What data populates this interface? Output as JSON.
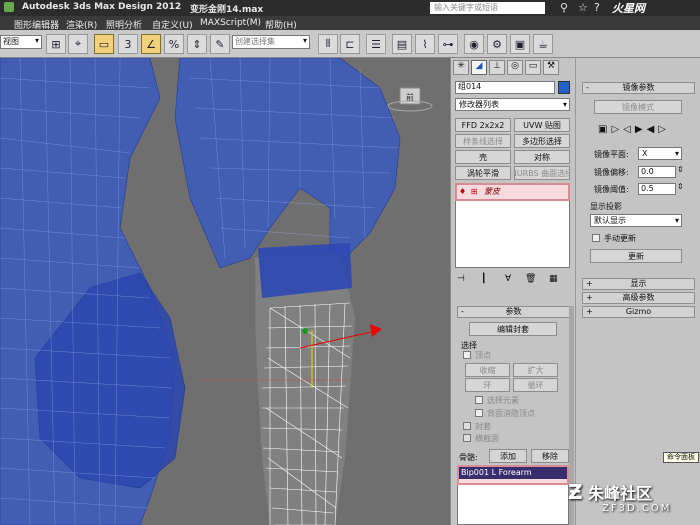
{
  "app": {
    "title": "Autodesk 3ds Max Design 2012",
    "file": "变形金刚14.max",
    "search_placeholder": "输入关键字或短语"
  },
  "menu": [
    "图形编辑器",
    "渲染(R)",
    "照明分析",
    "自定义(U)",
    "MAXScript(M)",
    "帮助(H)"
  ],
  "toolbar": {
    "view_dropdown": "视图",
    "selection_set": "创建选择集",
    "selection_set_short": "ß"
  },
  "viewport": {
    "cube_label": "前"
  },
  "modify_panel": {
    "object_name": "组014",
    "modifier_list": "修改器列表",
    "buttons": [
      "FFD 2x2x2",
      "UVW 贴图",
      "样条线选择",
      "多边形选择",
      "壳",
      "对称",
      "涡轮平滑",
      "NURBS 曲面选择"
    ],
    "stack_item": "蒙皮",
    "params_header": "参数",
    "edit_envelopes": "编辑封套",
    "select_label": "选择",
    "vertices": "顶点",
    "shrink": "收缩",
    "grow": "扩大",
    "ring": "环",
    "loop": "循环",
    "select_element": "选择元素",
    "backface_cull": "背面消隐顶点",
    "envelopes": "封套",
    "cross_sections": "横截面",
    "bones_label": "骨骼:",
    "add": "添加",
    "remove": "移除",
    "bone_item": "Bip001 L Forearm"
  },
  "mirror_rollout": {
    "header": "镜像参数",
    "mirror_mode": "镜像模式",
    "mirror_plane_label": "镜像平面:",
    "mirror_plane_value": "X",
    "mirror_offset_label": "镜像偏移:",
    "mirror_offset_value": "0.0",
    "mirror_threshold_label": "镜像阈值:",
    "mirror_threshold_value": "0.5",
    "display_projection": "显示投影",
    "default_display": "默认显示",
    "manual_update": "手动更新",
    "update": "更新",
    "display_rollout": "显示",
    "advanced_rollout": "高级参数",
    "gizmo_rollout": "Gizmo"
  },
  "tooltip": "命令面板",
  "watermark": {
    "top": "火星网 hxsd.com",
    "bottom_cn": "朱峰社区",
    "bottom_en": "ZF3D.COM"
  },
  "colors": {
    "viewport_bg": "#6f6f6f",
    "wire_blue": "#2d4fb8",
    "highlight": "#d98c96"
  }
}
